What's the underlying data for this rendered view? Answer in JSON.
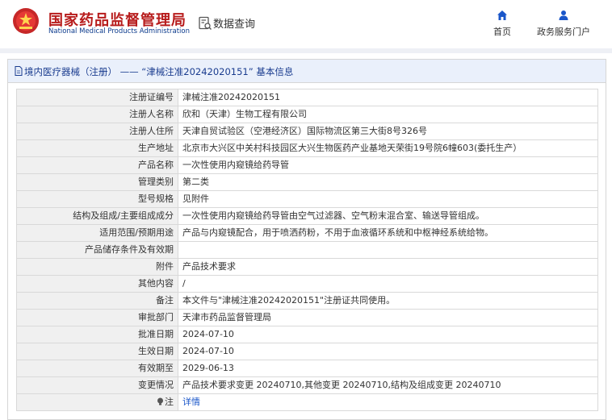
{
  "header": {
    "logo_cn": "国家药品监督管理局",
    "logo_en": "National Medical Products Administration",
    "query_label": "数据查询",
    "nav": {
      "home": "首页",
      "portal": "政务服务门户"
    }
  },
  "panel": {
    "title": "境内医疗器械（注册） —— “津械注准20242020151” 基本信息"
  },
  "rows": [
    {
      "label": "注册证编号",
      "value": "津械注准20242020151"
    },
    {
      "label": "注册人名称",
      "value": "欣和（天津）生物工程有限公司"
    },
    {
      "label": "注册人住所",
      "value": "天津自贸试验区（空港经济区）国际物流区第三大街8号326号"
    },
    {
      "label": "生产地址",
      "value": "北京市大兴区中关村科技园区大兴生物医药产业基地天荣街19号院6幢603(委托生产）"
    },
    {
      "label": "产品名称",
      "value": "一次性使用内窥镜给药导管"
    },
    {
      "label": "管理类别",
      "value": "第二类"
    },
    {
      "label": "型号规格",
      "value": "见附件"
    },
    {
      "label": "结构及组成/主要组成成分",
      "value": "一次性使用内窥镜给药导管由空气过滤器、空气粉末混合室、输送导管组成。"
    },
    {
      "label": "适用范围/预期用途",
      "value": "产品与内窥镜配合，用于喷洒药粉，不用于血液循环系统和中枢神经系统给物。"
    },
    {
      "label": "产品储存条件及有效期",
      "value": ""
    },
    {
      "label": "附件",
      "value": "产品技术要求"
    },
    {
      "label": "其他内容",
      "value": "/"
    },
    {
      "label": "备注",
      "value": "本文件与\"津械注准20242020151\"注册证共同使用。"
    },
    {
      "label": "审批部门",
      "value": "天津市药品监督管理局"
    },
    {
      "label": "批准日期",
      "value": "2024-07-10"
    },
    {
      "label": "生效日期",
      "value": "2024-07-10"
    },
    {
      "label": "有效期至",
      "value": "2029-06-13"
    },
    {
      "label": "变更情况",
      "value": "产品技术要求变更 20240710,其他变更 20240710,结构及组成变更 20240710"
    },
    {
      "label": "注",
      "value": "详情",
      "link": true
    }
  ],
  "colors": {
    "brand_red": "#b71c1c",
    "brand_blue": "#0b3a8c",
    "link": "#1a56c9",
    "panel_head": "#eaf0fb"
  }
}
